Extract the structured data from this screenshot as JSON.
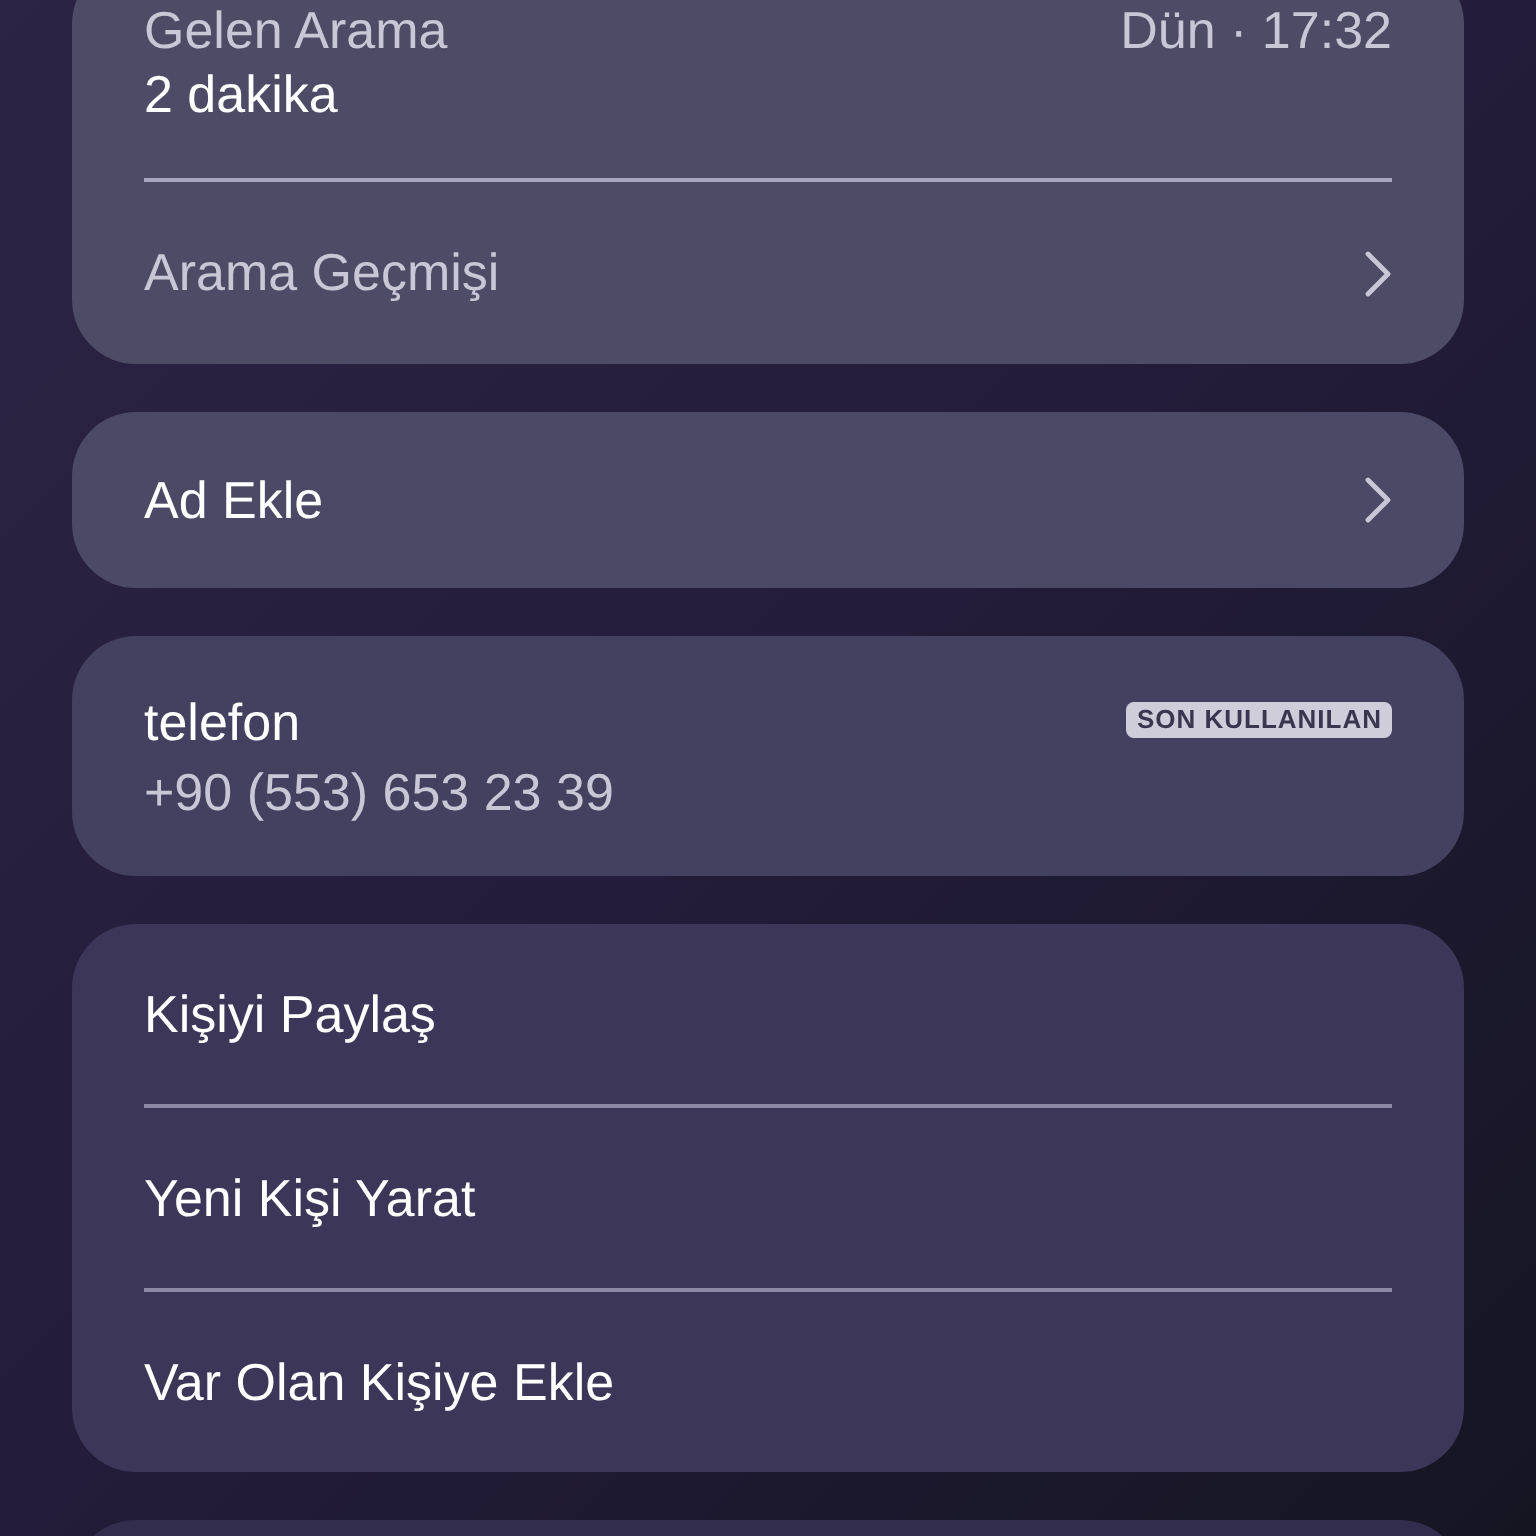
{
  "recent_call": {
    "type": "Gelen Arama",
    "duration": "2 dakika",
    "time": "Dün · 17:32"
  },
  "call_history": {
    "label": "Arama Geçmişi"
  },
  "add_name": {
    "label": "Ad Ekle"
  },
  "phone": {
    "label": "telefon",
    "number": "+90 (553) 653 23 39",
    "badge": "SON KULLANILAN"
  },
  "actions": [
    "Kişiyi Paylaş",
    "Yeni Kişi Yarat",
    "Var Olan Kişiye Ekle"
  ]
}
